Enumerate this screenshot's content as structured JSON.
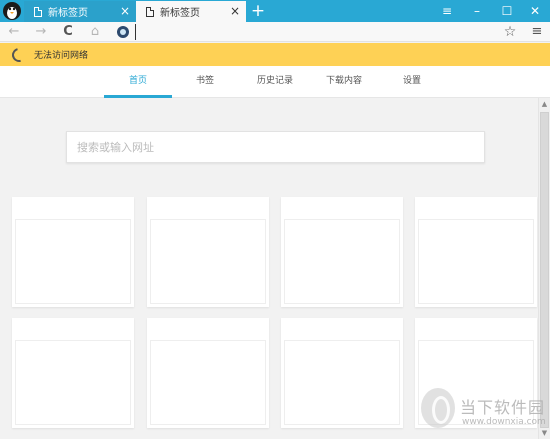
{
  "titlebar": {
    "tabs": [
      {
        "label": "新标签页",
        "close": "×"
      },
      {
        "label": "新标签页",
        "close": "×"
      }
    ],
    "new_tab": "+",
    "window_buttons": {
      "menu": "≡",
      "minimize": "–",
      "maximize": "☐",
      "close": "✕"
    }
  },
  "navbar": {
    "back": "←",
    "forward": "→",
    "reload": "C",
    "home": "⌂",
    "url": "",
    "bookmark": "☆",
    "menu": "≡"
  },
  "warning": {
    "text": "无法访问网络"
  },
  "newtab_menu": {
    "items": [
      "首页",
      "书签",
      "历史记录",
      "下载内容",
      "设置"
    ],
    "selected": "首页"
  },
  "search": {
    "placeholder": "搜索或输入网址"
  },
  "watermark": {
    "text": "当下软件园",
    "url": "www.downxia.com"
  },
  "scroll": {
    "up": "▲",
    "down": "▼"
  },
  "colors": {
    "accent": "#29a8d4",
    "warning": "#fed155"
  }
}
